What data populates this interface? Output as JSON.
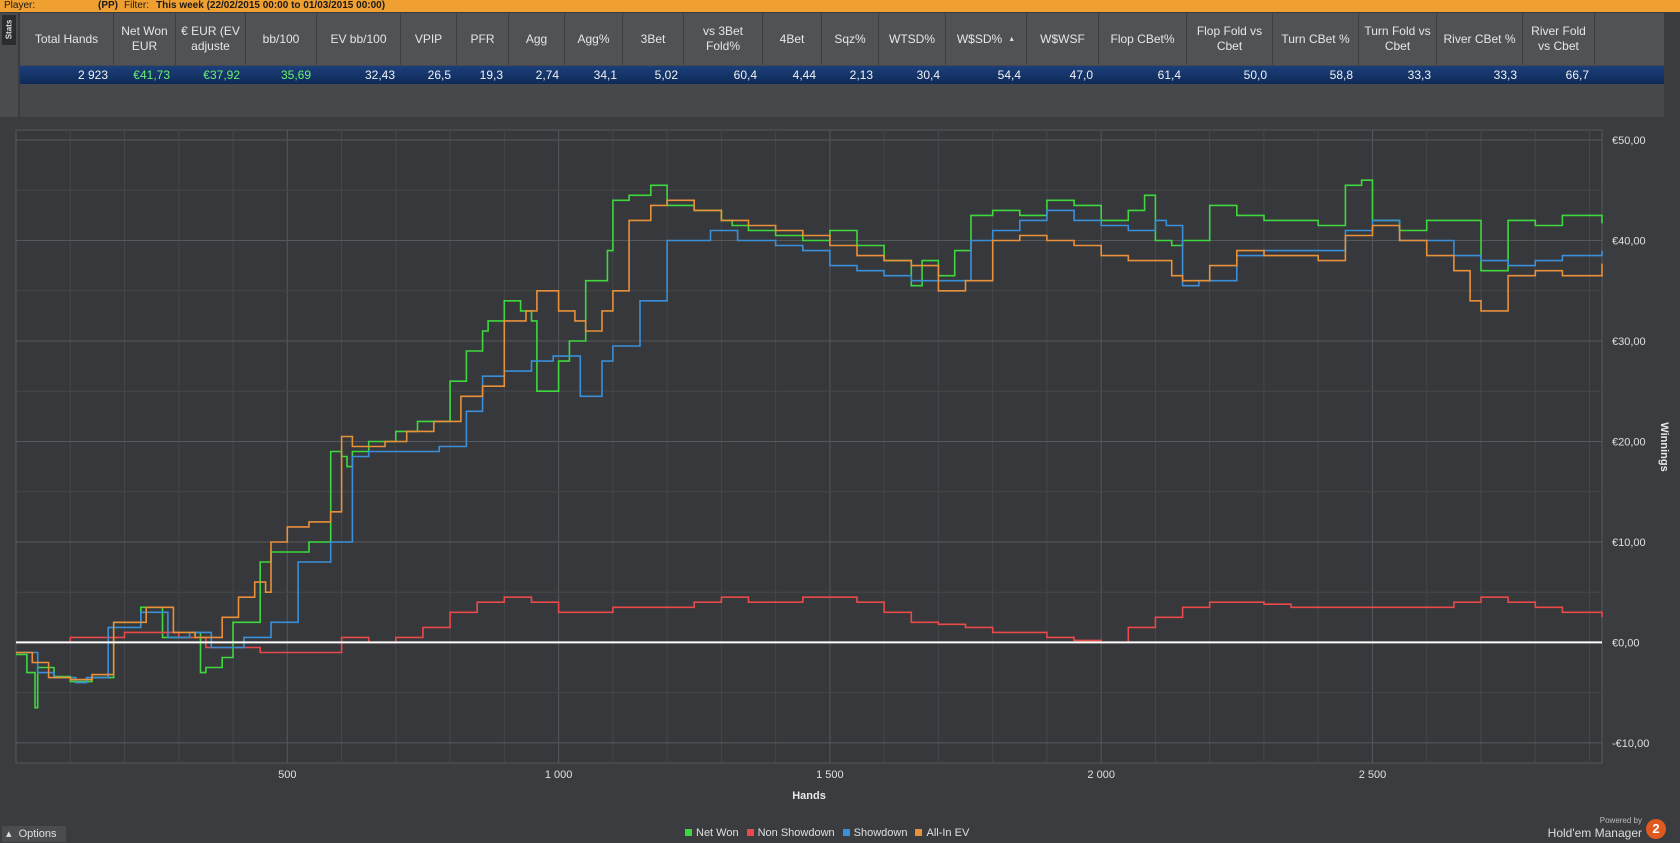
{
  "topbar": {
    "player_label": "Player:",
    "player_value": "(PP)",
    "filter_label": "Filter:",
    "filter_value": "This week (22/02/2015 00:00 to 01/03/2015 00:00)"
  },
  "stats_tab_label": "Stats",
  "stats": {
    "columns": [
      {
        "header": "Total Hands",
        "value": "2 923"
      },
      {
        "header": "Net Won EUR",
        "value": "€41,73",
        "accent": "#6cf06c"
      },
      {
        "header": "€ EUR (EV adjuste",
        "value": "€37,92",
        "accent": "#6cf06c"
      },
      {
        "header": "bb/100",
        "value": "35,69",
        "accent": "#6cf06c"
      },
      {
        "header": "EV bb/100",
        "value": "32,43"
      },
      {
        "header": "VPIP",
        "value": "26,5"
      },
      {
        "header": "PFR",
        "value": "19,3"
      },
      {
        "header": "Agg",
        "value": "2,74"
      },
      {
        "header": "Agg%",
        "value": "34,1"
      },
      {
        "header": "3Bet",
        "value": "5,02"
      },
      {
        "header": "vs 3Bet Fold%",
        "value": "60,4"
      },
      {
        "header": "4Bet",
        "value": "4,44"
      },
      {
        "header": "Sqz%",
        "value": "2,13"
      },
      {
        "header": "WTSD%",
        "value": "30,4"
      },
      {
        "header": "W$SD%",
        "value": "54,4",
        "sorted": true,
        "sort_icon": "sort-ascending-icon"
      },
      {
        "header": "W$WSF",
        "value": "47,0"
      },
      {
        "header": "Flop CBet%",
        "value": "61,4"
      },
      {
        "header": "Flop Fold vs Cbet",
        "value": "50,0"
      },
      {
        "header": "Turn CBet %",
        "value": "58,8"
      },
      {
        "header": "Turn Fold vs Cbet",
        "value": "33,3"
      },
      {
        "header": "River CBet %",
        "value": "33,3"
      },
      {
        "header": "River Fold vs Cbet",
        "value": "66,7"
      }
    ]
  },
  "chart_data": {
    "type": "line",
    "xlabel": "Hands",
    "ylabel": "Winnings",
    "xlim": [
      0,
      2923
    ],
    "ylim": [
      -12,
      51
    ],
    "x_ticks": [
      500,
      1000,
      1500,
      2000,
      2500
    ],
    "x_tick_labels": [
      "500",
      "1 000",
      "1 500",
      "2 000",
      "2 500"
    ],
    "y_ticks": [
      -10,
      0,
      10,
      20,
      30,
      40,
      50
    ],
    "y_tick_labels": [
      "-€10,00",
      "€0,00",
      "€10,00",
      "€20,00",
      "€30,00",
      "€40,00",
      "€50,00"
    ],
    "grid": true,
    "legend_position": "bottom",
    "series": [
      {
        "name": "Net Won",
        "color": "#3ed83e",
        "x": [
          0,
          20,
          35,
          40,
          70,
          100,
          140,
          180,
          230,
          270,
          330,
          340,
          350,
          380,
          400,
          450,
          470,
          540,
          580,
          600,
          610,
          620,
          650,
          700,
          740,
          800,
          830,
          860,
          870,
          900,
          930,
          950,
          960,
          1000,
          1020,
          1050,
          1090,
          1100,
          1130,
          1170,
          1200,
          1250,
          1300,
          1320,
          1350,
          1400,
          1450,
          1500,
          1550,
          1600,
          1650,
          1670,
          1700,
          1730,
          1760,
          1800,
          1850,
          1900,
          1950,
          2000,
          2050,
          2080,
          2100,
          2130,
          2150,
          2200,
          2250,
          2300,
          2400,
          2450,
          2480,
          2500,
          2550,
          2600,
          2700,
          2750,
          2800,
          2850,
          2923
        ],
        "y": [
          -1.2,
          -3,
          -6.5,
          -2.5,
          -3.4,
          -3.9,
          -3.5,
          2,
          3.5,
          0.5,
          1,
          -3,
          -2.5,
          -1.5,
          2,
          8,
          9,
          10,
          19,
          18.5,
          17.5,
          19,
          20,
          21,
          22,
          26,
          29,
          31,
          32,
          34,
          33,
          32,
          25,
          28,
          30,
          36,
          39,
          44,
          44.5,
          45.5,
          43.5,
          43,
          42,
          41.5,
          41,
          40.5,
          40,
          41,
          39.5,
          38,
          35.5,
          38,
          36.5,
          39,
          42.5,
          43,
          42.5,
          44,
          43.5,
          42,
          43,
          44.5,
          40,
          39.5,
          40,
          43.5,
          42.5,
          42,
          41.5,
          45.5,
          46,
          42,
          41,
          42,
          37,
          42,
          41.5,
          42.5,
          41.7
        ]
      },
      {
        "name": "Non Showdown",
        "color": "#e84a4a",
        "x": [
          0,
          50,
          100,
          150,
          200,
          300,
          350,
          400,
          450,
          500,
          550,
          600,
          650,
          700,
          750,
          800,
          850,
          900,
          950,
          1000,
          1050,
          1100,
          1150,
          1200,
          1250,
          1300,
          1350,
          1400,
          1450,
          1500,
          1550,
          1600,
          1650,
          1700,
          1750,
          1800,
          1850,
          1900,
          1950,
          2000,
          2050,
          2100,
          2150,
          2200,
          2250,
          2300,
          2350,
          2400,
          2450,
          2500,
          2550,
          2600,
          2650,
          2700,
          2750,
          2800,
          2850,
          2923
        ],
        "y": [
          0,
          0,
          0.5,
          0.5,
          1,
          0.5,
          -0.5,
          -0.5,
          -1,
          -1,
          -1,
          0.5,
          0,
          0.5,
          1.5,
          3,
          4,
          4.5,
          4,
          3,
          3,
          3.5,
          3.5,
          3.5,
          4,
          4.5,
          4,
          4,
          4.5,
          4.5,
          4,
          3,
          2,
          1.8,
          1.5,
          1,
          1,
          0.5,
          0.2,
          0,
          1.5,
          2.5,
          3.5,
          4,
          4,
          3.8,
          3.5,
          3.5,
          3.5,
          3.5,
          3.5,
          3.5,
          4,
          4.5,
          4,
          3.5,
          3,
          2.5
        ]
      },
      {
        "name": "Showdown",
        "color": "#3a8fd8",
        "x": [
          0,
          40,
          70,
          110,
          130,
          170,
          230,
          280,
          320,
          360,
          420,
          470,
          520,
          580,
          620,
          650,
          700,
          780,
          830,
          860,
          900,
          950,
          990,
          1020,
          1040,
          1080,
          1100,
          1150,
          1200,
          1280,
          1330,
          1400,
          1450,
          1500,
          1550,
          1600,
          1650,
          1700,
          1760,
          1800,
          1850,
          1900,
          1950,
          2000,
          2050,
          2100,
          2120,
          2150,
          2180,
          2200,
          2250,
          2300,
          2450,
          2500,
          2550,
          2650,
          2700,
          2750,
          2800,
          2850,
          2923
        ],
        "y": [
          -1,
          -3,
          -3.5,
          -4,
          -3.5,
          1.5,
          3,
          0.5,
          1,
          -0.5,
          0.5,
          2,
          8,
          10,
          18.5,
          19,
          19,
          19.5,
          23,
          26.5,
          27,
          28,
          28.5,
          28.5,
          24.5,
          28,
          29.5,
          34,
          40,
          41,
          40,
          39.5,
          39,
          37.5,
          37,
          36.5,
          36,
          36,
          40,
          41,
          42,
          43,
          42,
          41.5,
          41,
          42,
          41.5,
          35.5,
          36,
          36,
          38.5,
          39,
          41,
          42,
          40,
          38.5,
          38,
          37.5,
          38,
          38.5,
          39
        ]
      },
      {
        "name": "All-In EV",
        "color": "#e8903a",
        "x": [
          0,
          30,
          60,
          100,
          140,
          180,
          240,
          290,
          330,
          380,
          410,
          440,
          460,
          470,
          500,
          540,
          580,
          600,
          620,
          680,
          720,
          770,
          820,
          860,
          900,
          940,
          960,
          1000,
          1030,
          1050,
          1080,
          1100,
          1130,
          1170,
          1200,
          1250,
          1300,
          1350,
          1400,
          1450,
          1500,
          1550,
          1600,
          1650,
          1700,
          1750,
          1800,
          1850,
          1900,
          1950,
          2000,
          2050,
          2100,
          2130,
          2150,
          2200,
          2250,
          2300,
          2400,
          2450,
          2500,
          2550,
          2600,
          2650,
          2680,
          2700,
          2750,
          2800,
          2850,
          2923
        ],
        "y": [
          -1,
          -2,
          -3.5,
          -3.7,
          -3.2,
          2,
          3.5,
          1,
          0.5,
          2.5,
          4.5,
          6,
          5,
          10,
          11.5,
          12,
          13,
          20.5,
          19.5,
          20,
          21,
          22,
          24.5,
          25.5,
          32,
          33,
          35,
          33,
          32,
          31,
          33,
          35,
          42,
          43.5,
          44,
          43,
          42,
          41.5,
          41,
          40.5,
          39.5,
          38.5,
          38,
          37.5,
          35,
          36,
          40,
          40.5,
          40,
          39.5,
          38.5,
          38,
          38,
          36.5,
          36,
          37.5,
          39,
          38.5,
          38,
          40.5,
          41.5,
          40,
          38.5,
          37,
          34,
          33,
          36.5,
          37,
          36.5,
          37.7
        ]
      }
    ]
  },
  "options_label": "Options",
  "branding": {
    "powered_by": "Powered by",
    "product": "Hold'em Manager",
    "logo_text": "2"
  }
}
